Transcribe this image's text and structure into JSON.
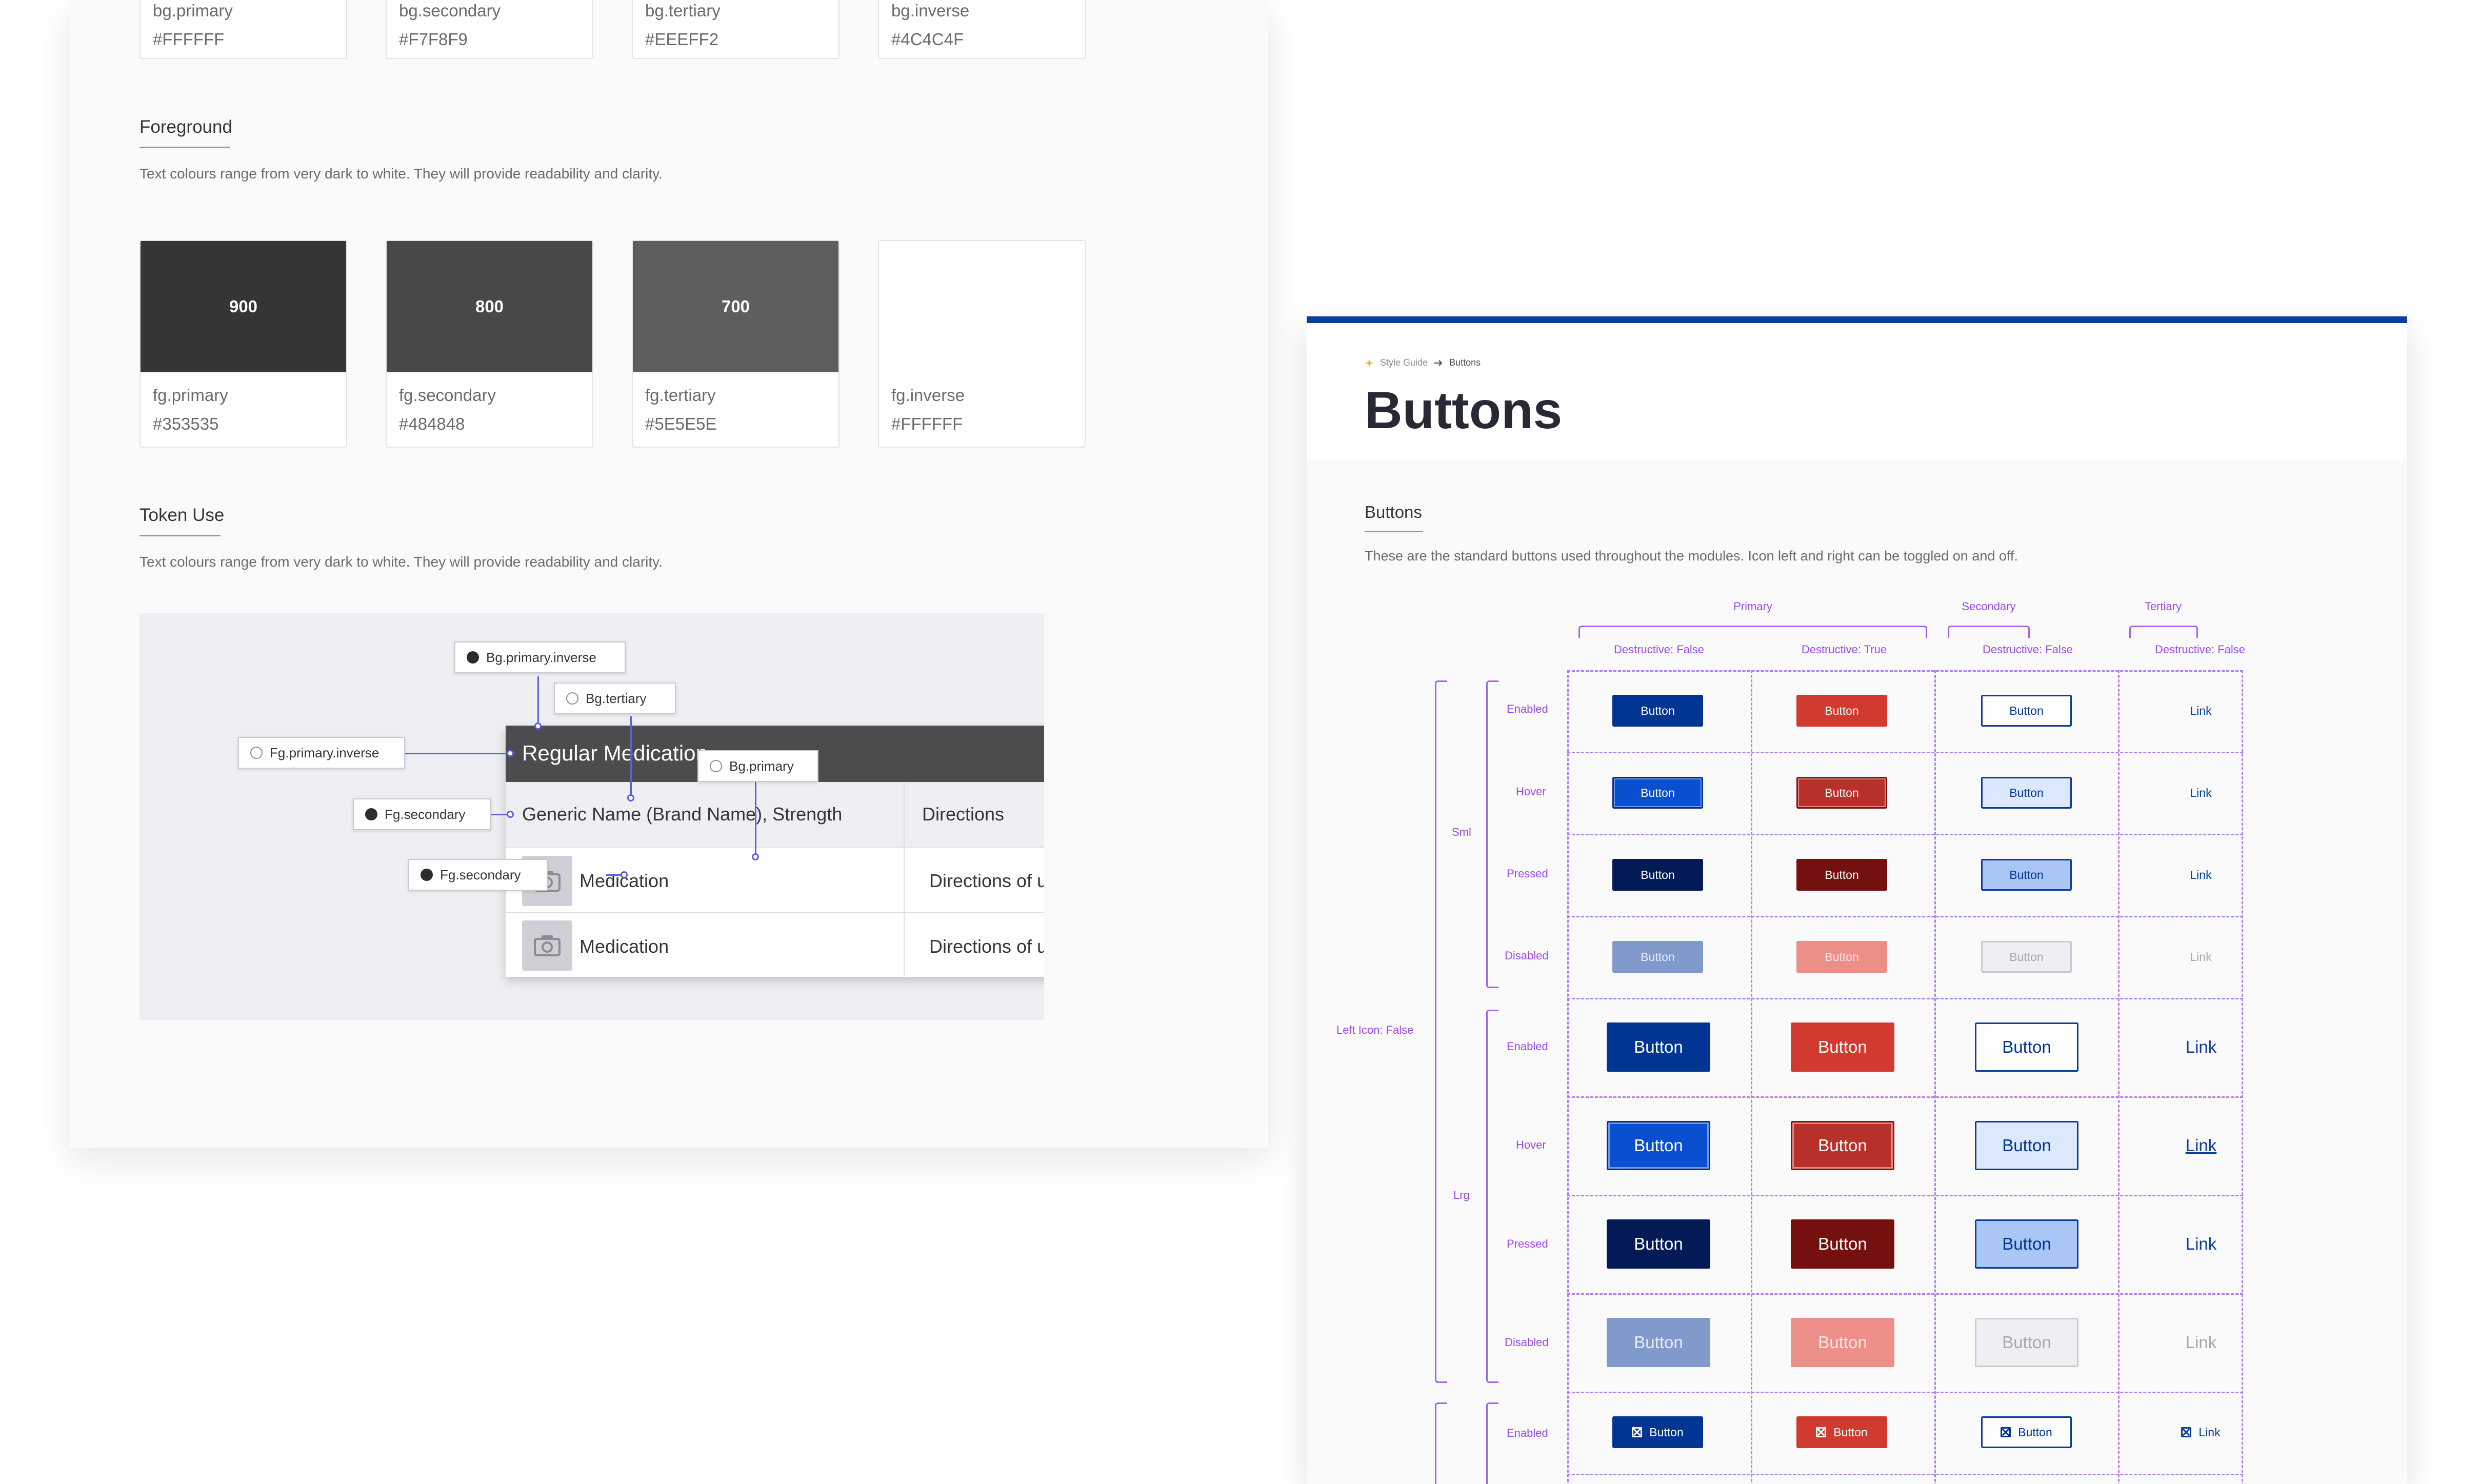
{
  "background_tokens": [
    {
      "name": "bg.primary",
      "hex": "#FFFFFF"
    },
    {
      "name": "bg.secondary",
      "hex": "#F7F8F9"
    },
    {
      "name": "bg.tertiary",
      "hex": "#EEEFF2"
    },
    {
      "name": "bg.inverse",
      "hex": "#4C4C4F"
    }
  ],
  "foreground": {
    "title": "Foreground",
    "description": "Text colours range from very dark to white. They will provide readability and clarity.",
    "tokens": [
      {
        "swatch_label": "900",
        "name": "fg.primary",
        "hex": "#353535"
      },
      {
        "swatch_label": "800",
        "name": "fg.secondary",
        "hex": "#484848"
      },
      {
        "swatch_label": "700",
        "name": "fg.tertiary",
        "hex": "#5E5E5E"
      },
      {
        "swatch_label": "",
        "name": "fg.inverse",
        "hex": "#FFFFFF"
      }
    ]
  },
  "token_use": {
    "title": "Token Use",
    "description": "Text colours range from very dark to white. They will provide readability and clarity.",
    "table": {
      "header": "Regular Medication",
      "col1": "Generic Name (Brand Name), Strength",
      "col2": "Directions",
      "rows": [
        {
          "name": "Medication",
          "directions": "Directions of use"
        },
        {
          "name": "Medication",
          "directions": "Directions of use"
        }
      ]
    },
    "tags": {
      "bg_primary_inverse_top": "Bg.primary.inverse",
      "bg_tertiary": "Bg.tertiary",
      "fg_primary_inverse": "Fg.primary.inverse",
      "bg_primary": "Bg.primary",
      "fg_secondary_a": "Fg.secondary",
      "fg_secondary_b": "Fg.secondary"
    }
  },
  "buttons_page": {
    "breadcrumb": [
      "Style Guide",
      "Buttons"
    ],
    "title": "Buttons",
    "section_title": "Buttons",
    "section_desc": "These are the standard buttons used throughout the modules. Icon left and right can be toggled on and off.",
    "groups": {
      "primary": "Primary",
      "secondary": "Secondary",
      "tertiary": "Tertiary"
    },
    "columns": [
      "Destructive: False",
      "Destructive: True",
      "Destructive: False",
      "Destructive: False"
    ],
    "size_labels": {
      "sml": "Sml",
      "lrg": "Lrg"
    },
    "left_icon_label": "Left Icon: False",
    "states": [
      "Enabled",
      "Hover",
      "Pressed",
      "Disabled"
    ],
    "button_label": "Button",
    "link_label": "Link",
    "colors": {
      "primary": "#003594",
      "primary_hover": "#0b4fd1",
      "primary_pressed": "#021b57",
      "primary_disabled": "#7f9acb",
      "destructive": "#d13a2f",
      "destructive_hover": "#b8302a",
      "destructive_pressed": "#74100e",
      "destructive_disabled": "#eb8f88",
      "accent_purple": "#9b4be8"
    }
  }
}
